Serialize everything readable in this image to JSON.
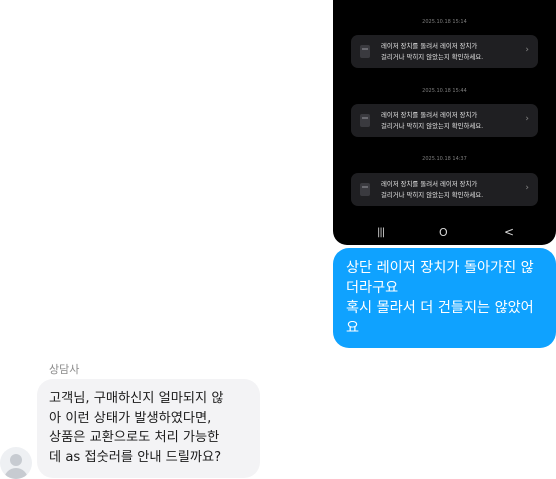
{
  "phone": {
    "notifications": [
      {
        "timestamp": "2025.10.18 15:14",
        "line1": "레이저 장치를 돌려서 레이저 장치가",
        "line2": "걸리거나 막히지 않았는지 확인하세요."
      },
      {
        "timestamp": "2025.10.18 15:44",
        "line1": "레이저 장치를 돌려서 레이저 장치가",
        "line2": "걸리거나 막히지 않았는지 확인하세요."
      },
      {
        "timestamp": "2025.10.18 14:37",
        "line1": "레이저 장치를 돌려서 레이저 장치가",
        "line2": "걸리거나 막히지 않았는지 확인하세요."
      }
    ],
    "nav": {
      "recents": "|||",
      "home": "O",
      "back": "<"
    }
  },
  "messages": {
    "user": {
      "lines": [
        "상단 레이저 장치가 돌아가진 않",
        "더라구요",
        "혹시 몰라서 더 건들지는 않았어",
        "요"
      ]
    },
    "agent": {
      "sender": "상담사",
      "lines": [
        "고객님, 구매하신지 얼마되지 않",
        "아 이런 상태가 발생하였다면,",
        "상품은 교환으로도 처리 가능한",
        "데 as 접숫러를 안내 드릴까요?"
      ]
    }
  },
  "colors": {
    "user_bubble": "#0fa2ff",
    "agent_bubble": "#f3f3f5",
    "phone_bg": "#000000"
  }
}
